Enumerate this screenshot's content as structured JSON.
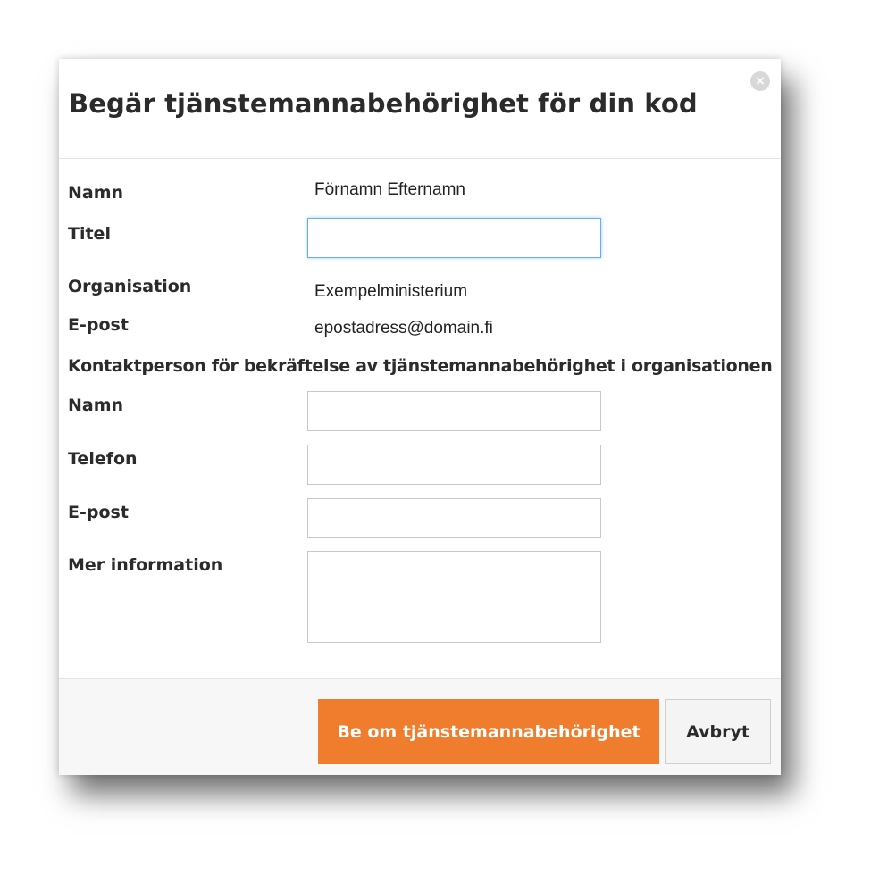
{
  "dialog": {
    "title": "Begär tjänstemannabehörighet för din kod",
    "close_icon": "close-icon"
  },
  "profile": {
    "name_label": "Namn",
    "name_value": "Förnamn Efternamn",
    "title_label": "Titel",
    "title_value": "",
    "organisation_label": "Organisation",
    "organisation_value": "Exempelministerium",
    "email_label": "E-post",
    "email_value": "epostadress@domain.fi"
  },
  "contact": {
    "heading": "Kontaktperson för bekräftelse av tjänstemannabehörighet i organisationen",
    "name_label": "Namn",
    "name_value": "",
    "phone_label": "Telefon",
    "phone_value": "",
    "email_label": "E-post",
    "email_value": "",
    "info_label": "Mer information",
    "info_value": ""
  },
  "footer": {
    "submit_label": "Be om tjänstemannabehörighet",
    "cancel_label": "Avbryt",
    "accent_color": "#f07c2e"
  }
}
